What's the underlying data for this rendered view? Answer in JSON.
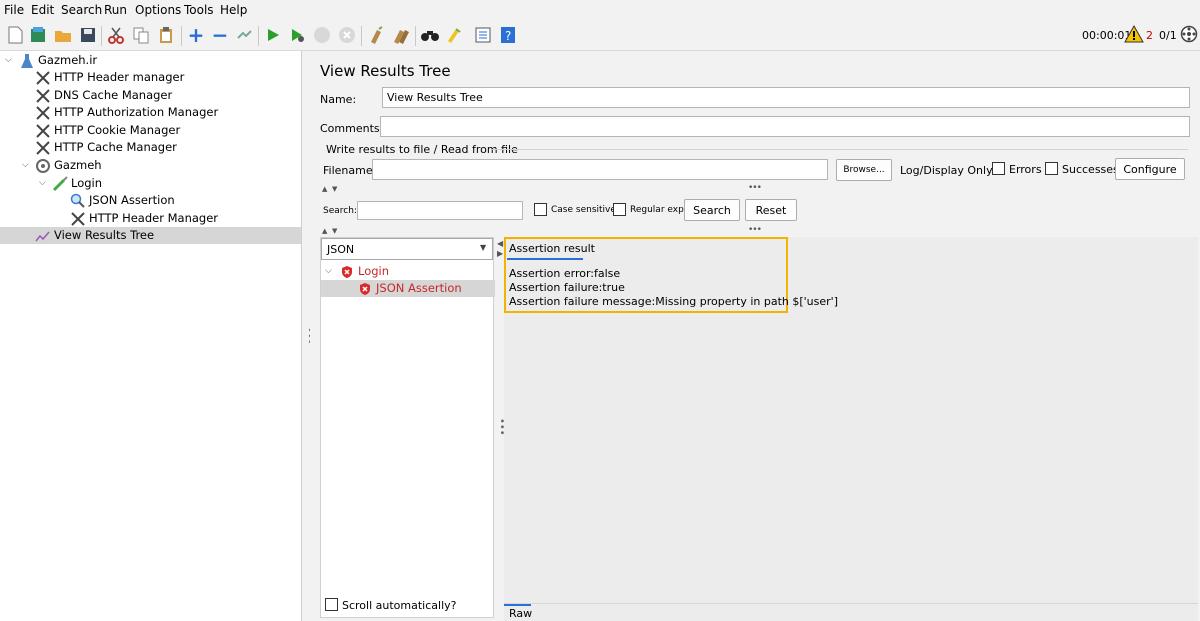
{
  "menu": [
    "File",
    "Edit",
    "Search",
    "Run",
    "Options",
    "Tools",
    "Help"
  ],
  "toolbar": {
    "icons": [
      "new-icon",
      "templates-icon",
      "open-icon",
      "save-icon",
      "cut-icon",
      "copy-icon",
      "paste-icon",
      "expand-icon",
      "collapse-icon",
      "toggle-icon",
      "start-icon",
      "start-no-pause-icon",
      "stop-icon",
      "shutdown-icon",
      "clear-icon",
      "clear-all-icon",
      "search-icon",
      "reset-search-icon",
      "function-helper-icon",
      "help-icon"
    ],
    "timer": "00:00:01",
    "warning_count": "2",
    "threads": "0/1"
  },
  "tree": [
    {
      "label": "Gazmeh.ir",
      "icon": "test-plan-icon",
      "level": 0,
      "expanded": true
    },
    {
      "label": "HTTP Header manager",
      "icon": "wrench-icon",
      "level": 1
    },
    {
      "label": "DNS Cache Manager",
      "icon": "wrench-icon",
      "level": 1
    },
    {
      "label": "HTTP Authorization Manager",
      "icon": "wrench-icon",
      "level": 1
    },
    {
      "label": "HTTP Cookie Manager",
      "icon": "wrench-icon",
      "level": 1
    },
    {
      "label": "HTTP Cache Manager",
      "icon": "wrench-icon",
      "level": 1
    },
    {
      "label": "Gazmeh",
      "icon": "thread-group-icon",
      "level": 1,
      "expanded": true
    },
    {
      "label": "Login",
      "icon": "sampler-icon",
      "level": 2,
      "expanded": true
    },
    {
      "label": "JSON Assertion",
      "icon": "assertion-icon",
      "level": 3
    },
    {
      "label": "HTTP Header Manager",
      "icon": "wrench-icon",
      "level": 3
    },
    {
      "label": "View Results Tree",
      "icon": "listener-icon",
      "level": 1,
      "selected": true
    }
  ],
  "panel": {
    "title": "View Results Tree",
    "name_label": "Name:",
    "name_value": "View Results Tree",
    "comments_label": "Comments:",
    "comments_value": "",
    "file_section_title": "Write results to file / Read from file",
    "filename_label": "Filename",
    "filename_value": "",
    "browse_label": "Browse...",
    "log_display_label": "Log/Display Only:",
    "errors_label": "Errors",
    "successes_label": "Successes",
    "configure_label": "Configure",
    "search_label": "Search:",
    "search_value": "",
    "case_sensitive_label": "Case sensitive",
    "regular_exp_label": "Regular exp.",
    "search_button": "Search",
    "reset_button": "Reset"
  },
  "results": {
    "renderer": "JSON",
    "items": [
      {
        "label": "Login",
        "level": 0,
        "status": "error"
      },
      {
        "label": "JSON Assertion",
        "level": 1,
        "status": "error",
        "selected": true
      }
    ],
    "scroll_auto_label": "Scroll automatically?"
  },
  "assertion": {
    "tab": "Assertion result",
    "lines": [
      "Assertion error:false",
      "Assertion failure:true",
      "Assertion failure message:Missing property in path $['user']"
    ],
    "bottom_tab": "Raw",
    "highlight_color": "#f5b300"
  }
}
